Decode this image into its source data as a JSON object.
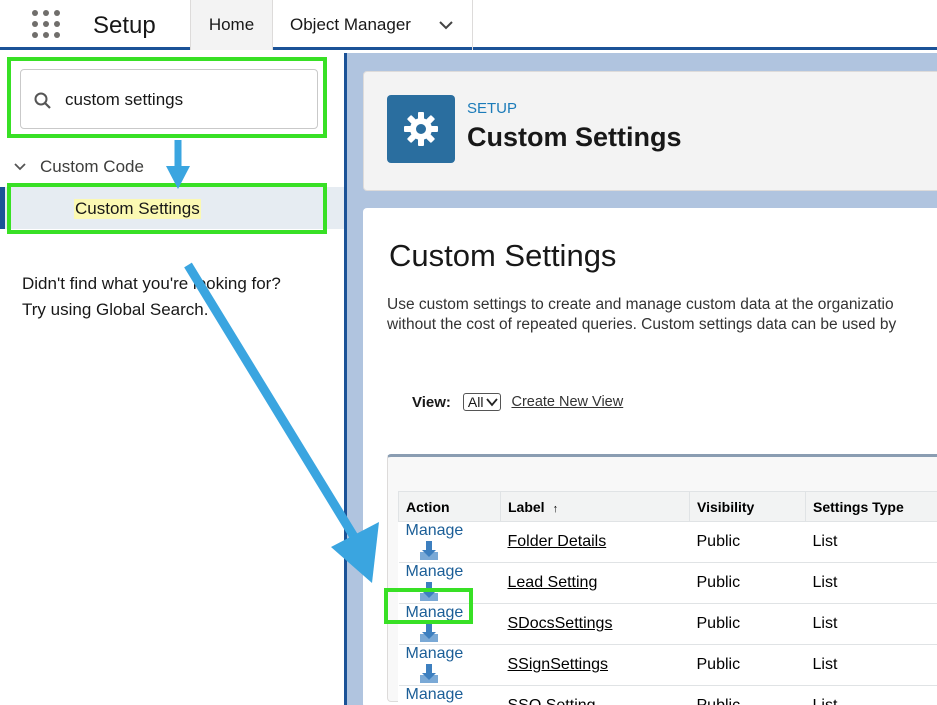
{
  "topbar": {
    "app_name": "Setup",
    "tabs": [
      {
        "label": "Home"
      },
      {
        "label": "Object Manager"
      }
    ]
  },
  "sidebar": {
    "search_value": "custom settings",
    "tree_parent": "Custom Code",
    "tree_child": "Custom Settings",
    "not_found_line1": "Didn't find what you're looking for?",
    "not_found_line2": "Try using Global Search."
  },
  "header": {
    "eyebrow": "SETUP",
    "title": "Custom Settings",
    "icon": "gear-icon"
  },
  "content": {
    "heading": "Custom Settings",
    "desc_line1": "Use custom settings to create and manage custom data at the organizatio",
    "desc_line2": "without the cost of repeated queries. Custom settings data can be used by",
    "view_label": "View:",
    "view_value": "All",
    "create_view": "Create New View"
  },
  "table": {
    "columns": [
      "Action",
      "Label",
      "Visibility",
      "Settings Type"
    ],
    "sort_indicator": "↑",
    "rows": [
      {
        "action": "Manage",
        "label": "Folder Details",
        "visibility": "Public",
        "type": "List"
      },
      {
        "action": "Manage",
        "label": "Lead Setting",
        "visibility": "Public",
        "type": "List"
      },
      {
        "action": "Manage",
        "label": "SDocsSettings",
        "visibility": "Public",
        "type": "List"
      },
      {
        "action": "Manage",
        "label": "SSignSettings",
        "visibility": "Public",
        "type": "List"
      },
      {
        "action": "Manage",
        "label": "SSO Setting",
        "visibility": "Public",
        "type": "List"
      }
    ]
  },
  "colors": {
    "brand_blue": "#1b5297",
    "highlight_green": "#38e025",
    "arrow_blue": "#3aa5e0",
    "header_icon_bg": "#2a6e9f"
  }
}
